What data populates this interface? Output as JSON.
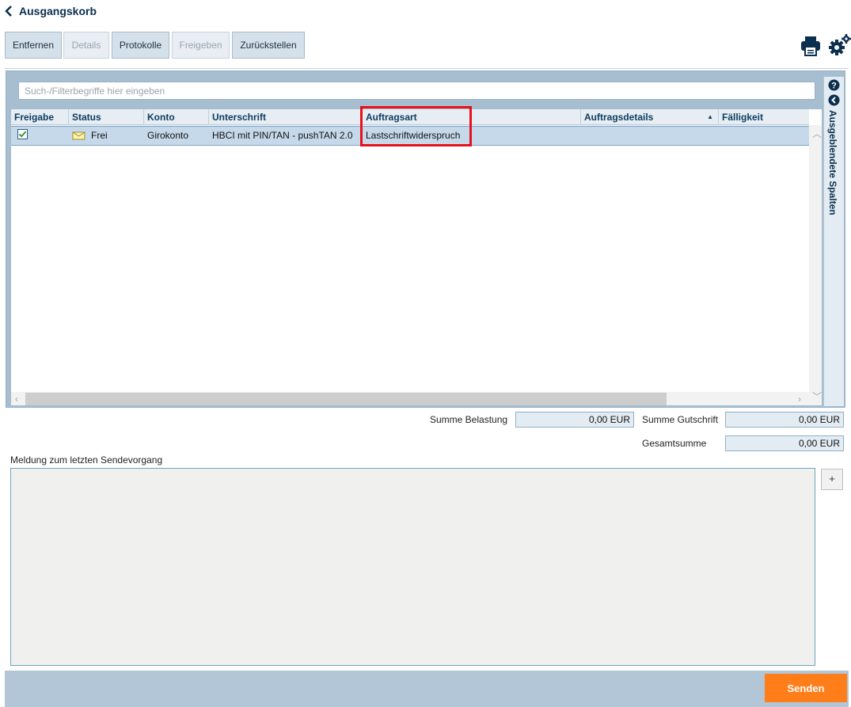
{
  "header": {
    "title": "Ausgangskorb",
    "back_icon": "chevron-left-icon"
  },
  "toolbar": {
    "buttons": [
      {
        "label": "Entfernen",
        "enabled": true
      },
      {
        "label": "Details",
        "enabled": false
      },
      {
        "label": "Protokolle",
        "enabled": true
      },
      {
        "label": "Freigeben",
        "enabled": false
      },
      {
        "label": "Zurückstellen",
        "enabled": true
      }
    ],
    "icons": [
      "printer-icon",
      "settings-gear-icon"
    ]
  },
  "search": {
    "placeholder": "Such-/Filterbegriffe hier eingeben",
    "value": ""
  },
  "table": {
    "columns": [
      "Freigabe",
      "Status",
      "Konto",
      "Unterschrift",
      "Auftragsart",
      "Auftragsdetails",
      "Fälligkeit"
    ],
    "sorted_column": "Auftragsdetails",
    "sort_direction": "ascending",
    "highlighted_column": "Auftragsart",
    "rows": [
      {
        "freigabe_checked": true,
        "status": "Frei",
        "konto": "Girokonto",
        "unterschrift": "HBCI mit PIN/TAN - pushTAN 2.0",
        "auftragsart": "Lastschriftwiderspruch",
        "auftragsdetails": "",
        "faelligkeit": ""
      }
    ]
  },
  "side_panel": {
    "label": "Ausgeblendete Spalten",
    "icons": [
      "help-icon",
      "collapse-left-icon"
    ]
  },
  "sums": {
    "belastung_label": "Summe Belastung",
    "belastung_value": "0,00 EUR",
    "gutschrift_label": "Summe Gutschrift",
    "gutschrift_value": "0,00 EUR",
    "gesamt_label": "Gesamtsumme",
    "gesamt_value": "0,00 EUR"
  },
  "message": {
    "label": "Meldung zum letzten Sendevorgang",
    "text": "",
    "expand_label": "+"
  },
  "send": {
    "label": "Senden"
  },
  "colors": {
    "accent_orange": "#ff7e1a",
    "highlight_red": "#e8111b",
    "header_text": "#0b2f4f"
  }
}
